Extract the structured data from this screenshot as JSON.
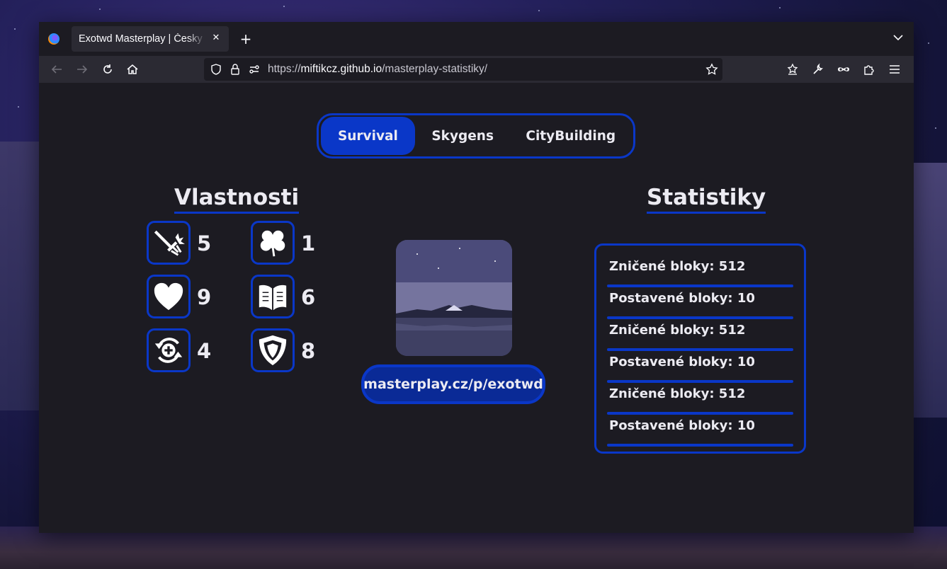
{
  "browser": {
    "tab_title": "Exotwd Masterplay | Česky",
    "url_scheme": "https://",
    "url_host": "miftikcz.github.io",
    "url_path": "/masterplay-statistiky/",
    "new_tab_glyph": "+",
    "close_glyph": "✕"
  },
  "modes": {
    "tabs": [
      {
        "label": "Survival",
        "active": true
      },
      {
        "label": "Skygens",
        "active": false
      },
      {
        "label": "CityBuilding",
        "active": false
      }
    ]
  },
  "attributes": {
    "title": "Vlastnosti",
    "items": [
      {
        "icon": "sword-icon",
        "value": "5"
      },
      {
        "icon": "clover-icon",
        "value": "1"
      },
      {
        "icon": "heart-icon",
        "value": "9"
      },
      {
        "icon": "book-icon",
        "value": "6"
      },
      {
        "icon": "regeneration-icon",
        "value": "4"
      },
      {
        "icon": "shield-icon",
        "value": "8"
      }
    ]
  },
  "profile": {
    "link": "masterplay.cz/p/exotwd"
  },
  "stats": {
    "title": "Statistiky",
    "rows": [
      "Zničené bloky: 512",
      "Postavené bloky: 10",
      "Zničené bloky: 512",
      "Postavené bloky: 10",
      "Zničené bloky: 512",
      "Postavené bloky: 10"
    ]
  },
  "colors": {
    "accent": "#0a37c8",
    "background": "#1c1b22",
    "text": "#ecebf2"
  }
}
